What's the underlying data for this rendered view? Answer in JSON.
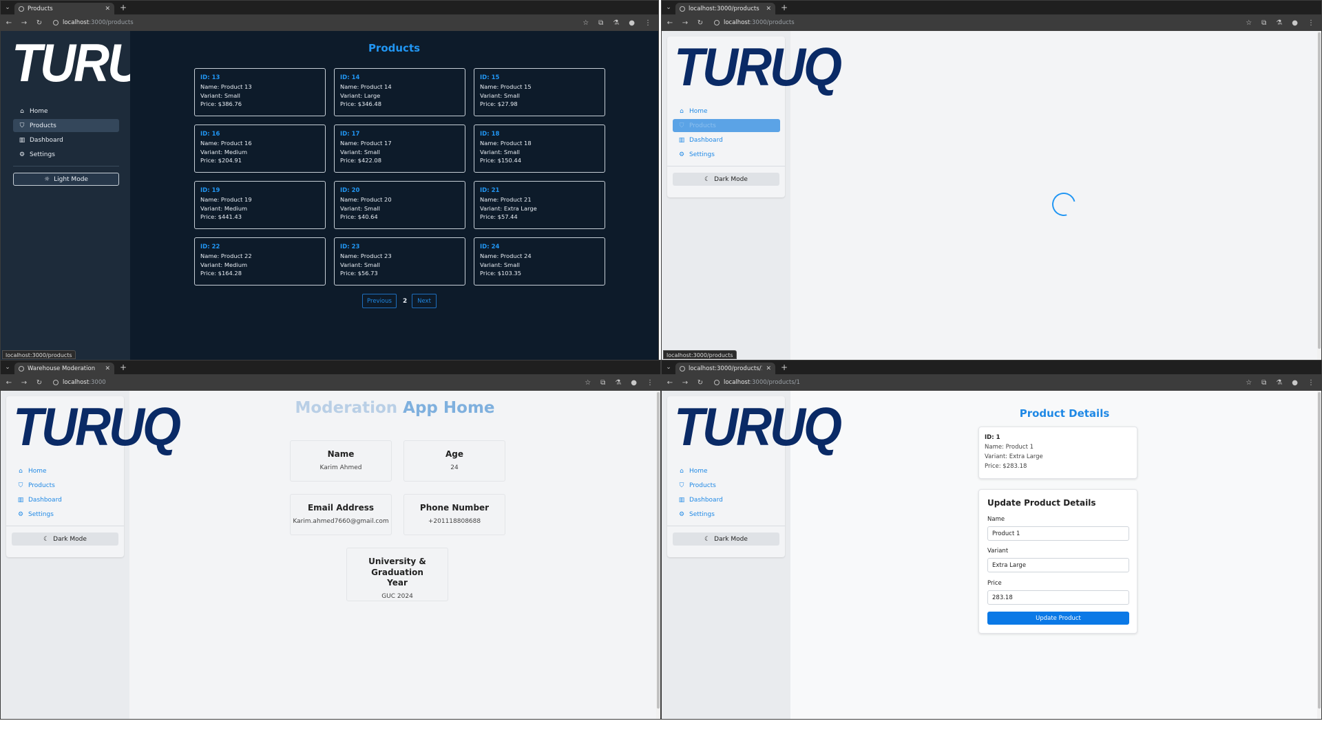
{
  "colors": {
    "accent": "#2196f3",
    "navy_logo": "#0a2a66",
    "dark_sidebar": "#1d2b3a",
    "dark_main": "#0d1b2a",
    "light_sidebar": "#e9ebee",
    "light_main": "#f3f4f6"
  },
  "windows": {
    "top_left": {
      "tab_title": "Products",
      "url_host": "localhost",
      "url_path": ":3000/products",
      "status_url": "localhost:3000/products",
      "logo": "TURUQ",
      "nav": [
        {
          "label": "Home",
          "icon": "home-icon"
        },
        {
          "label": "Products",
          "icon": "bag-icon"
        },
        {
          "label": "Dashboard",
          "icon": "chart-icon"
        },
        {
          "label": "Settings",
          "icon": "gear-icon"
        }
      ],
      "mode_button": "Light Mode",
      "page_title": "Products",
      "products": [
        {
          "id": "ID: 13",
          "name": "Name: Product 13",
          "variant": "Variant: Small",
          "price": "Price: $386.76"
        },
        {
          "id": "ID: 14",
          "name": "Name: Product 14",
          "variant": "Variant: Large",
          "price": "Price: $346.48"
        },
        {
          "id": "ID: 15",
          "name": "Name: Product 15",
          "variant": "Variant: Small",
          "price": "Price: $27.98"
        },
        {
          "id": "ID: 16",
          "name": "Name: Product 16",
          "variant": "Variant: Medium",
          "price": "Price: $204.91"
        },
        {
          "id": "ID: 17",
          "name": "Name: Product 17",
          "variant": "Variant: Small",
          "price": "Price: $422.08"
        },
        {
          "id": "ID: 18",
          "name": "Name: Product 18",
          "variant": "Variant: Small",
          "price": "Price: $150.44"
        },
        {
          "id": "ID: 19",
          "name": "Name: Product 19",
          "variant": "Variant: Medium",
          "price": "Price: $441.43"
        },
        {
          "id": "ID: 20",
          "name": "Name: Product 20",
          "variant": "Variant: Small",
          "price": "Price: $40.64"
        },
        {
          "id": "ID: 21",
          "name": "Name: Product 21",
          "variant": "Variant: Extra Large",
          "price": "Price: $57.44"
        },
        {
          "id": "ID: 22",
          "name": "Name: Product 22",
          "variant": "Variant: Medium",
          "price": "Price: $164.28"
        },
        {
          "id": "ID: 23",
          "name": "Name: Product 23",
          "variant": "Variant: Small",
          "price": "Price: $56.73"
        },
        {
          "id": "ID: 24",
          "name": "Name: Product 24",
          "variant": "Variant: Small",
          "price": "Price: $103.35"
        }
      ],
      "pager": {
        "previous": "Previous",
        "page": "2",
        "next": "Next"
      }
    },
    "top_right": {
      "tab_title": "localhost:3000/products",
      "url_host": "localhost",
      "url_path": ":3000/products",
      "status_url": "localhost:3000/products",
      "logo": "TURUQ",
      "nav": [
        {
          "label": "Home",
          "icon": "home-icon"
        },
        {
          "label": "Products",
          "icon": "bag-icon"
        },
        {
          "label": "Dashboard",
          "icon": "chart-icon"
        },
        {
          "label": "Settings",
          "icon": "gear-icon"
        }
      ],
      "mode_button": "Dark Mode"
    },
    "bottom_left": {
      "tab_title": "Warehouse Moderation",
      "url_host": "localhost",
      "url_path": ":3000",
      "logo": "TURUQ",
      "nav": [
        {
          "label": "Home",
          "icon": "home-icon"
        },
        {
          "label": "Products",
          "icon": "bag-icon"
        },
        {
          "label": "Dashboard",
          "icon": "chart-icon"
        },
        {
          "label": "Settings",
          "icon": "gear-icon"
        }
      ],
      "mode_button": "Dark Mode",
      "title_part1": "Moderation ",
      "title_part2": "App Home",
      "cards": [
        {
          "head": "Name",
          "value": "Karim Ahmed"
        },
        {
          "head": "Age",
          "value": "24"
        },
        {
          "head": "Email Address",
          "value": "Karim.ahmed7660@gmail.com"
        },
        {
          "head": "Phone Number",
          "value": "+201118808688"
        },
        {
          "head": "University & Graduation Year",
          "value": "GUC 2024"
        }
      ]
    },
    "bottom_right": {
      "tab_title": "localhost:3000/products/1",
      "url_host": "localhost",
      "url_path": ":3000/products/1",
      "logo": "TURUQ",
      "nav": [
        {
          "label": "Home",
          "icon": "home-icon"
        },
        {
          "label": "Products",
          "icon": "bag-icon"
        },
        {
          "label": "Dashboard",
          "icon": "chart-icon"
        },
        {
          "label": "Settings",
          "icon": "gear-icon"
        }
      ],
      "mode_button": "Dark Mode",
      "page_title": "Product Details",
      "details": {
        "id": "ID: 1",
        "name": "Name: Product 1",
        "variant": "Variant: Extra Large",
        "price": "Price: $283.18"
      },
      "form": {
        "title": "Update Product Details",
        "name_label": "Name",
        "name_value": "Product 1",
        "variant_label": "Variant",
        "variant_value": "Extra Large",
        "price_label": "Price",
        "price_value": "283.18",
        "submit": "Update Product"
      }
    }
  }
}
